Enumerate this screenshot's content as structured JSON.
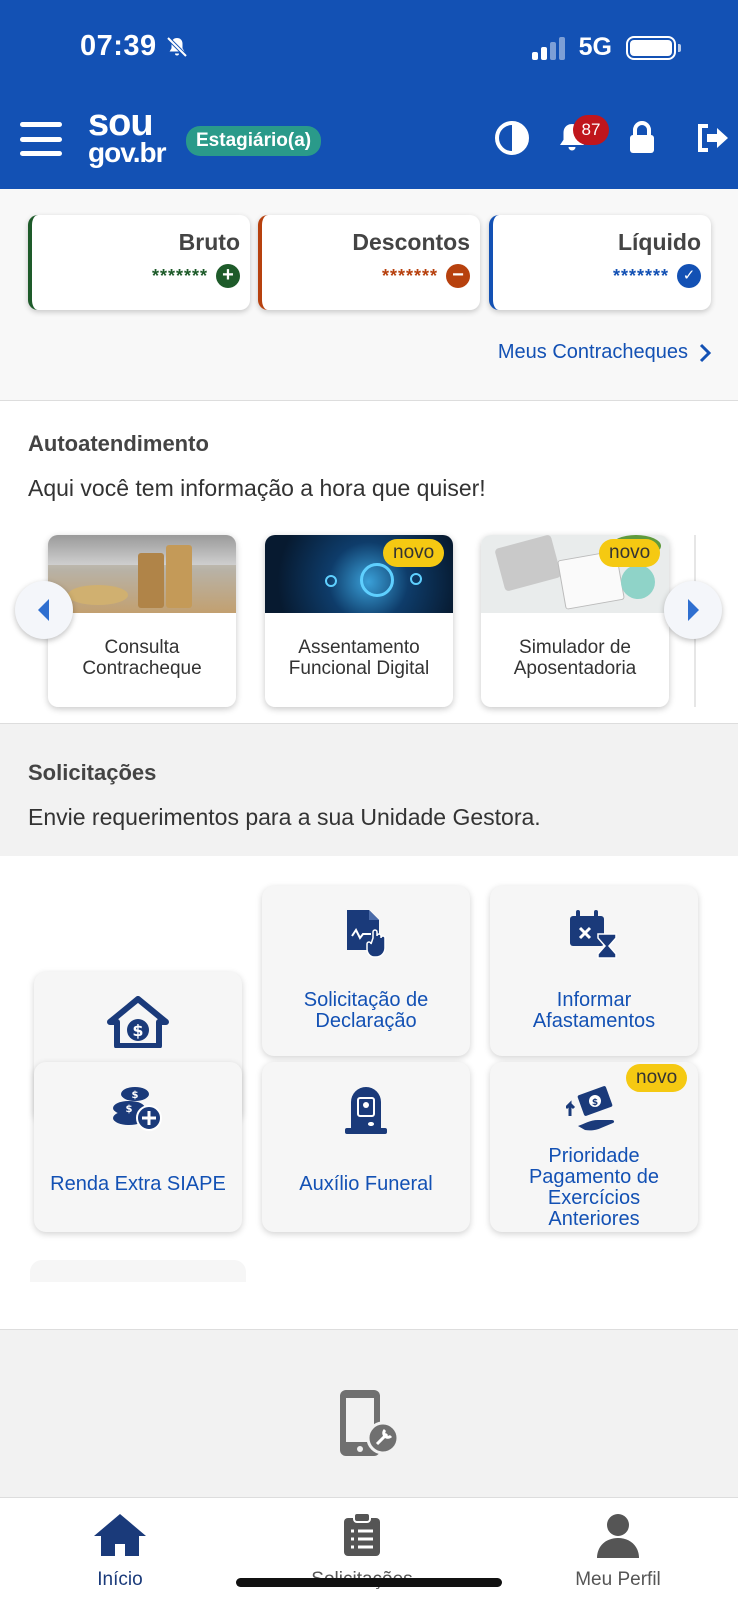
{
  "status_bar": {
    "time": "07:39",
    "network": "5G"
  },
  "header": {
    "logo_line1": "sou",
    "logo_line2": "gov.br",
    "role_badge": "Estagiário(a)",
    "notification_count": "87"
  },
  "summary": {
    "cards": [
      {
        "title": "Bruto",
        "mask": "*******",
        "icon": "plus-icon",
        "color": "#1e5b2a"
      },
      {
        "title": "Descontos",
        "mask": "*******",
        "icon": "minus-icon",
        "color": "#b7410e"
      },
      {
        "title": "Líquido",
        "mask": "*******",
        "icon": "check-icon",
        "color": "#1351b4"
      }
    ],
    "link": "Meus Contracheques"
  },
  "autoatendimento": {
    "title": "Autoatendimento",
    "subtitle": "Aqui você tem informação a hora que quiser!",
    "cards": [
      {
        "label_line1": "Consulta",
        "label_line2": "Contracheque",
        "badge": ""
      },
      {
        "label_line1": "Assentamento",
        "label_line2": "Funcional Digital",
        "badge": "novo"
      },
      {
        "label_line1": "Simulador de",
        "label_line2": "Aposentadoria",
        "badge": "novo"
      }
    ]
  },
  "solicitacoes": {
    "title": "Solicitações",
    "subtitle": "Envie requerimentos para a sua Unidade Gestora.",
    "tiles": [
      {
        "label_line1": "Solicitação de",
        "label_line2": "Declaração",
        "icon": "document-hand-icon"
      },
      {
        "label_line1": "Informar",
        "label_line2": "Afastamentos",
        "icon": "calendar-hourglass-icon"
      },
      {
        "label_line1": "",
        "label_line2": "",
        "icon": "house-money-icon"
      },
      {
        "label_line1": "Renda Extra SIAPE",
        "label_line2": "",
        "icon": "coins-plus-icon"
      },
      {
        "label_line1": "Auxílio Funeral",
        "label_line2": "",
        "icon": "tombstone-icon"
      },
      {
        "label_line1": "Prioridade",
        "label_line2": "Pagamento de",
        "label_line3": "Exercícios",
        "label_line4": "Anteriores",
        "icon": "hand-money-icon",
        "badge": "novo"
      }
    ]
  },
  "bottom_nav": {
    "items": [
      {
        "label": "Início",
        "icon": "home-icon",
        "active": true
      },
      {
        "label": "Solicitações",
        "icon": "clipboard-list-icon",
        "active": false
      },
      {
        "label": "Meu Perfil",
        "icon": "user-icon",
        "active": false
      }
    ]
  },
  "colors": {
    "primary": "#1351b4",
    "badge_green": "#2a9a8a",
    "novo_yellow": "#f5c912",
    "icon_navy": "#1a3a7a"
  }
}
